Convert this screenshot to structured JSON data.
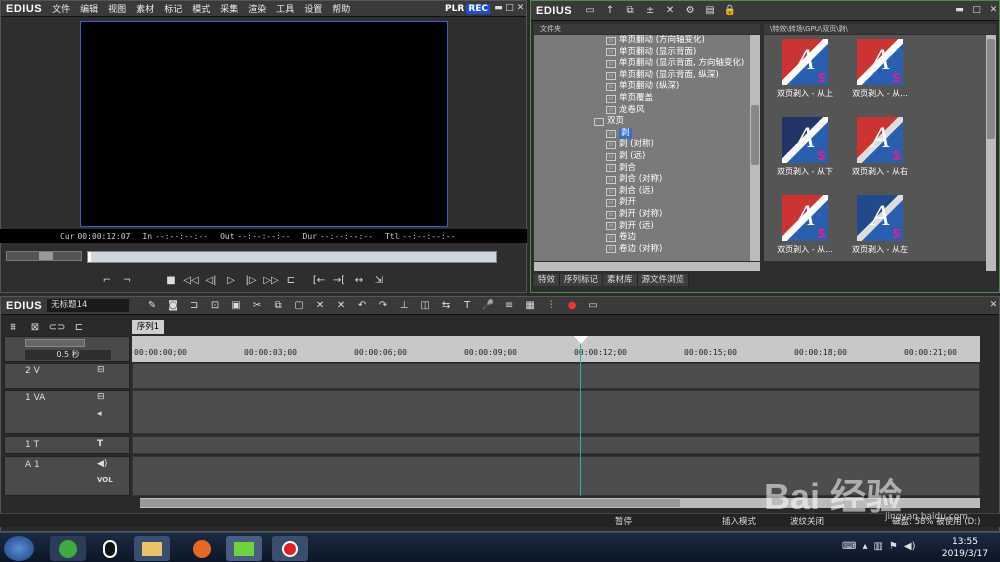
{
  "app": {
    "logo": "EDIUS"
  },
  "menu": [
    "文件",
    "编辑",
    "视图",
    "素材",
    "标记",
    "模式",
    "采集",
    "渲染",
    "工具",
    "设置",
    "帮助"
  ],
  "player": {
    "plr": "PLR",
    "rec": "REC",
    "cur_label": "Cur",
    "cur_value": "00:00:12:07",
    "in_label": "In",
    "in_value": "--:--:--:--",
    "out_label": "Out",
    "out_value": "--:--:--:--",
    "dur_label": "Dur",
    "dur_value": "--:--:--:--",
    "ttl_label": "Ttl",
    "ttl_value": "--:--:--:--"
  },
  "bin": {
    "logo": "EDIUS",
    "folder_header": "文件夹",
    "path": "\\特效\\转场\\GPU\\双页\\剥\\",
    "tree": [
      {
        "label": "单页翻动 (方向轴变化)",
        "indent": 72
      },
      {
        "label": "单页翻动 (显示背面)",
        "indent": 72
      },
      {
        "label": "单页翻动 (显示背面, 方向轴变化)",
        "indent": 72
      },
      {
        "label": "单页翻动 (显示背面, 纵深)",
        "indent": 72
      },
      {
        "label": "单页翻动 (纵深)",
        "indent": 72
      },
      {
        "label": "单页覆盖",
        "indent": 72
      },
      {
        "label": "龙卷风",
        "indent": 72
      },
      {
        "label": "双页",
        "indent": 60,
        "folder": true
      },
      {
        "label": "剥",
        "indent": 72,
        "selected": true
      },
      {
        "label": "剥 (对称)",
        "indent": 72
      },
      {
        "label": "剥 (远)",
        "indent": 72
      },
      {
        "label": "剥合",
        "indent": 72
      },
      {
        "label": "剥合 (对称)",
        "indent": 72
      },
      {
        "label": "剥合 (远)",
        "indent": 72
      },
      {
        "label": "剥开",
        "indent": 72
      },
      {
        "label": "剥开 (对称)",
        "indent": 72
      },
      {
        "label": "剥开 (远)",
        "indent": 72
      },
      {
        "label": "卷边",
        "indent": 72
      },
      {
        "label": "卷边 (对称)",
        "indent": 72
      }
    ],
    "thumbs": [
      {
        "label": "双页剥入 - 从上"
      },
      {
        "label": "双页剥入 - 从..."
      },
      {
        "label": "双页剥入 - 从下"
      },
      {
        "label": "双页剥入 - 从右"
      },
      {
        "label": "双页剥入 - 从..."
      },
      {
        "label": "双页剥入 - 从左"
      }
    ],
    "tabs": [
      "特效",
      "序列标记",
      "素材库",
      "源文件浏览"
    ]
  },
  "timeline": {
    "logo": "EDIUS",
    "project": "无标题14",
    "sequence_tab": "序列1",
    "scale": "0.5 秒",
    "ruler": [
      "00:00:00;00",
      "00:00:03;00",
      "00:00:06;00",
      "00:00:09;00",
      "00:00:12;00",
      "00:00:15;00",
      "00:00:18;00",
      "00:00:21;00"
    ],
    "tracks": {
      "v2": "2 V",
      "va1": "1 VA",
      "t1": "1 T",
      "a1": "1 A",
      "vol": "VOL",
      "a1_side": "A1",
      "a1b": "A 1"
    }
  },
  "statusbar": {
    "pause": "暂停",
    "insert": "插入模式",
    "wave": "波纹关闭",
    "disk": "磁盘: 58% 被使用 (D:)"
  },
  "taskbar": {
    "time": "13:55",
    "date": "2019/3/17"
  },
  "watermark": {
    "text": "Bai 经验",
    "url": "jingyan.baidu.com"
  },
  "colors": {
    "accent": "#3b5ec8",
    "rec": "#1d4fd6",
    "bin_border": "#4a8c4a",
    "playhead": "#2bb0b0"
  }
}
